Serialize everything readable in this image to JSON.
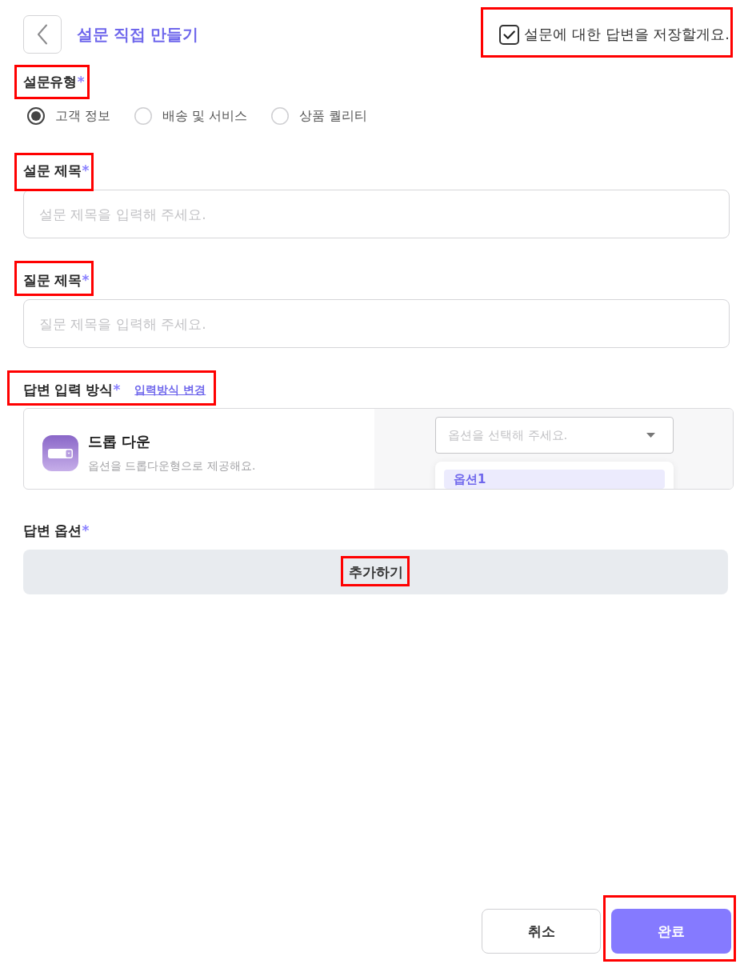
{
  "header": {
    "title": "설문 직접 만들기"
  },
  "save_answers": {
    "label": "설문에 대한 답변을 저장할게요.",
    "checked": true,
    "highlighted": true
  },
  "survey_type": {
    "label": "설문유형",
    "required_mark": "*",
    "highlighted": true,
    "options": [
      {
        "label": "고객 정보",
        "selected": true
      },
      {
        "label": "배송 및 서비스",
        "selected": false
      },
      {
        "label": "상품 퀄리티",
        "selected": false
      }
    ]
  },
  "survey_title": {
    "label": "설문 제목",
    "required_mark": "*",
    "highlighted": true,
    "placeholder": "설문 제목을 입력해 주세요."
  },
  "question_title": {
    "label": "질문 제목",
    "required_mark": "*",
    "highlighted": true,
    "placeholder": "질문 제목을 입력해 주세요."
  },
  "answer_input_type": {
    "label": "답변 입력 방식",
    "required_mark": "*",
    "link": "입력방식 변경",
    "highlighted": true,
    "selected_type": {
      "name": "드롭 다운",
      "description": "옵션을 드롭다운형으로 제공해요."
    },
    "preview": {
      "placeholder": "옵션을 선택해 주세요.",
      "options": [
        {
          "label": "옵션1",
          "selected": true
        }
      ]
    }
  },
  "answer_options": {
    "label": "답변 옵션",
    "required_mark": "*",
    "highlighted": false,
    "add_button": {
      "label": "추가하기",
      "highlighted": true
    }
  },
  "actions": [
    {
      "label": "취소",
      "kind": "secondary",
      "highlighted": false
    },
    {
      "label": "완료",
      "kind": "primary",
      "highlighted": true
    }
  ]
}
